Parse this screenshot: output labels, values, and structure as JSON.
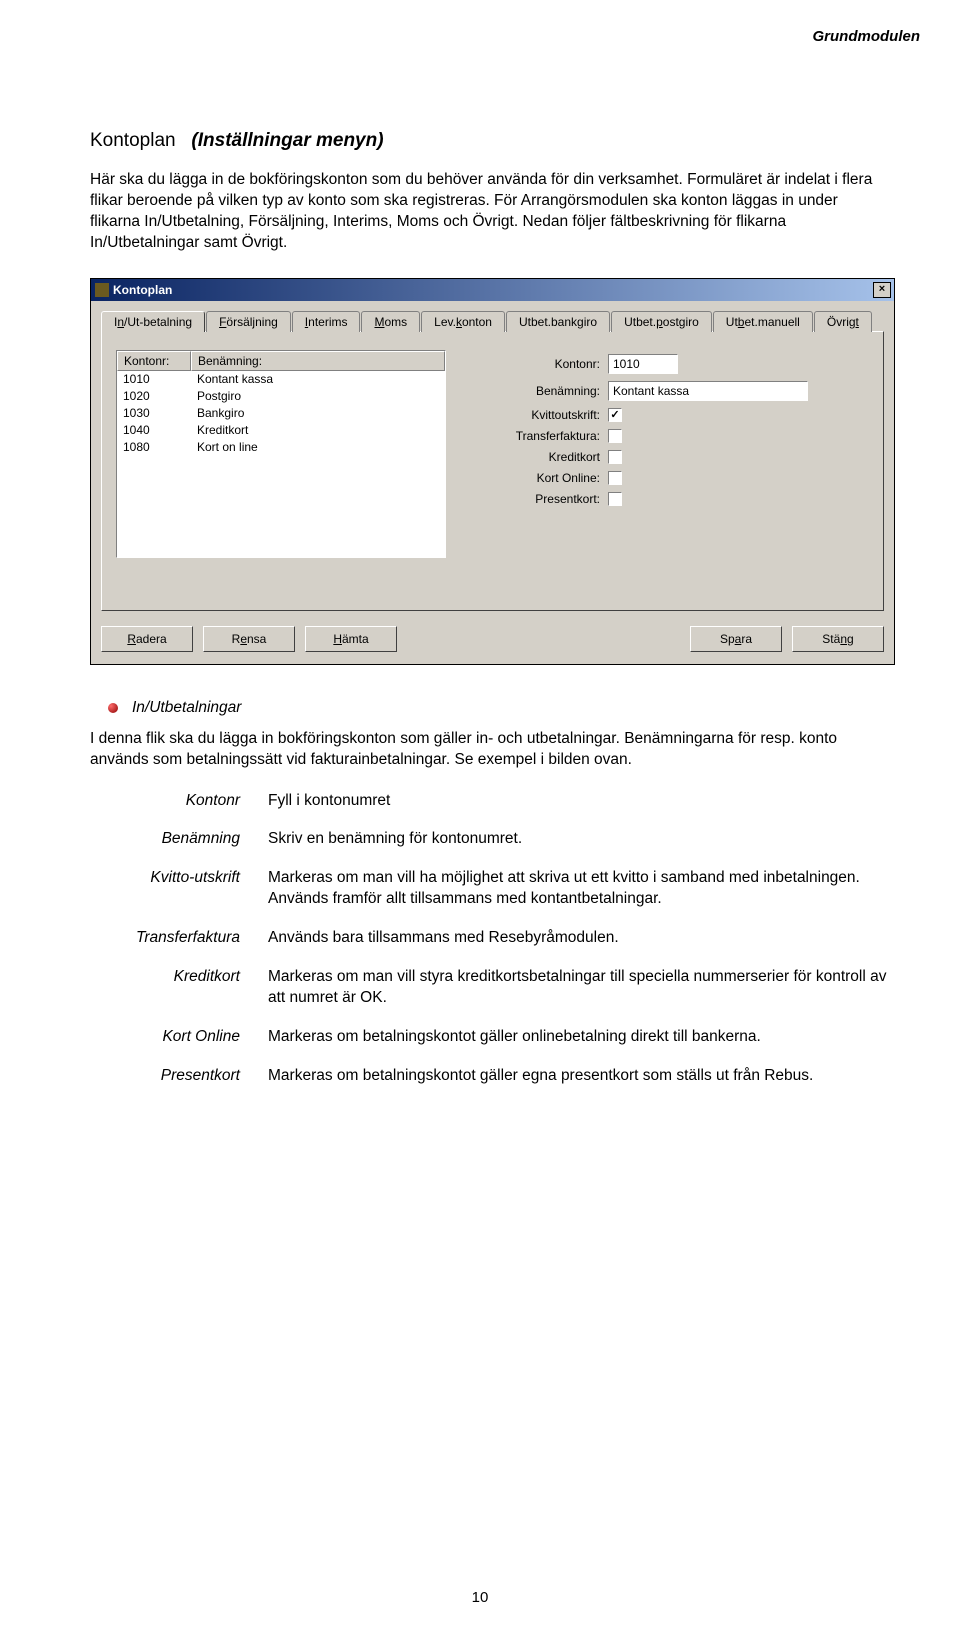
{
  "header": {
    "section": "Grundmodulen"
  },
  "title": {
    "main": "Kontoplan",
    "menu": "(Inställningar menyn)"
  },
  "paragraphs": {
    "intro": "Här ska du lägga in de bokföringskonton som du behöver använda för din verksamhet. Formuläret är indelat i flera flikar beroende på vilken typ av konto som ska registreras. För Arrangörsmodulen ska konton läggas in under flikarna In/Utbetalning, Försäljning, Interims, Moms och Övrigt. Nedan följer fältbeskrivning för flikarna In/Utbetalningar samt Övrigt.",
    "section_desc": "I denna flik ska du lägga in bokföringskonton som gäller in- och utbetalningar. Benämningarna för resp. konto används som betalningssätt vid fakturainbetalningar. Se exempel i bilden ovan."
  },
  "dialog": {
    "title": "Kontoplan",
    "close": "×",
    "tabs": [
      {
        "pre": "I",
        "u": "n",
        "post": "/Ut-betalning"
      },
      {
        "pre": "",
        "u": "F",
        "post": "örsäljning"
      },
      {
        "pre": "",
        "u": "I",
        "post": "nterims"
      },
      {
        "pre": "",
        "u": "M",
        "post": "oms"
      },
      {
        "pre": "Lev.",
        "u": "k",
        "post": "onton"
      },
      {
        "pre": "Utbet.bank",
        "u": "g",
        "post": "iro"
      },
      {
        "pre": "Utbet.",
        "u": "p",
        "post": "ostgiro"
      },
      {
        "pre": "Ut",
        "u": "b",
        "post": "et.manuell"
      },
      {
        "pre": "Övrig",
        "u": "t",
        "post": ""
      }
    ],
    "list": {
      "col_kontonr": "Kontonr:",
      "col_benamning": "Benämning:",
      "rows": [
        {
          "k": "1010",
          "b": "Kontant kassa"
        },
        {
          "k": "1020",
          "b": "Postgiro"
        },
        {
          "k": "1030",
          "b": "Bankgiro"
        },
        {
          "k": "1040",
          "b": "Kreditkort"
        },
        {
          "k": "1080",
          "b": "Kort on line"
        }
      ]
    },
    "form": {
      "kontonr_label": "Kontonr:",
      "kontonr_value": "1010",
      "benamning_label": "Benämning:",
      "benamning_value": "Kontant kassa",
      "kvittoutskrift_label": "Kvittoutskrift:",
      "kvittoutskrift_checked": "✓",
      "transferfaktura_label": "Transferfaktura:",
      "kreditkort_label": "Kreditkort",
      "kortonline_label": "Kort Online:",
      "presentkort_label": "Presentkort:"
    },
    "buttons": {
      "radera": {
        "u": "R",
        "post": "adera"
      },
      "rensa": {
        "pre": "R",
        "u": "e",
        "post": "nsa"
      },
      "hamta": {
        "u": "H",
        "post": "ämta"
      },
      "spara": {
        "pre": "Sp",
        "u": "a",
        "post": "ra"
      },
      "stang": {
        "pre": "Stä",
        "u": "n",
        "post": "g"
      }
    }
  },
  "section_heading": "In/Utbetalningar",
  "definitions": [
    {
      "term": "Kontonr",
      "desc": "Fyll i kontonumret"
    },
    {
      "term": "Benämning",
      "desc": "Skriv en benämning för kontonumret."
    },
    {
      "term": "Kvitto-utskrift",
      "desc": "Markeras om man vill ha möjlighet att skriva ut ett kvitto i samband med inbetalningen. Används framför allt tillsammans med kontantbetalningar."
    },
    {
      "term": "Transferfaktura",
      "desc": "Används bara tillsammans med Resebyråmodulen."
    },
    {
      "term": "Kreditkort",
      "desc": "Markeras om man vill styra kreditkortsbetalningar till speciella nummerserier för kontroll av att numret är OK."
    },
    {
      "term": "Kort Online",
      "desc": "Markeras om betalningskontot gäller onlinebetalning direkt till bankerna."
    },
    {
      "term": "Presentkort",
      "desc": "Markeras om betalningskontot gäller egna presentkort som ställs ut från Rebus."
    }
  ],
  "page_number": "10"
}
